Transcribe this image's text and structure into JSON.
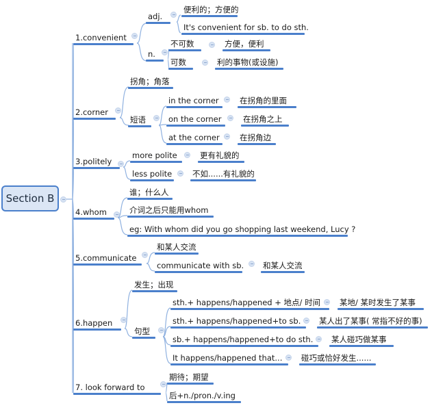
{
  "root": "Section B",
  "branches": [
    {
      "label": "1.convenient",
      "children": [
        {
          "label": "adj.",
          "children": [
            {
              "label": "便利的；方便的"
            },
            {
              "label": "It's convenient for sb. to do sth."
            }
          ]
        },
        {
          "label": "n.",
          "children": [
            {
              "label": "不可数",
              "note": "方便，便利"
            },
            {
              "label": "可数",
              "note": "利的事物(或设施)"
            }
          ]
        }
      ]
    },
    {
      "label": "2.corner",
      "children": [
        {
          "label": "拐角；角落"
        },
        {
          "label": "短语",
          "children": [
            {
              "label": "in the corner",
              "note": "在拐角的里面"
            },
            {
              "label": "on the corner",
              "note": "在拐角之上"
            },
            {
              "label": "at the corner",
              "note": "在拐角边"
            }
          ]
        }
      ]
    },
    {
      "label": "3.politely",
      "children": [
        {
          "label": "more polite",
          "note": "更有礼貌的"
        },
        {
          "label": "less polite",
          "note": "不如......有礼貌的"
        }
      ]
    },
    {
      "label": "4.whom",
      "children": [
        {
          "label": "谁；什么人"
        },
        {
          "label": "介词之后只能用whom"
        },
        {
          "label": "eg: With whom did you go shopping last weekend, Lucy ?"
        }
      ]
    },
    {
      "label": "5.communicate",
      "children": [
        {
          "label": "和某人交流"
        },
        {
          "label": "communicate with sb.",
          "note": "和某人交流"
        }
      ]
    },
    {
      "label": "6.happen",
      "children": [
        {
          "label": "发生；出现"
        },
        {
          "label": "句型",
          "children": [
            {
              "label": "sth.+ happens/happened + 地点/ 时间",
              "note": "某地/ 某时发生了某事"
            },
            {
              "label": "sth.+ happens/happened+to sb.",
              "note": "某人出了某事( 常指不好的事)"
            },
            {
              "label": "sb.+ happens/happened+to do sth.",
              "note": "某人碰巧做某事"
            },
            {
              "label": "It happens/happened that...",
              "note": "碰巧或恰好发生......"
            }
          ]
        }
      ]
    },
    {
      "label": "7. look forward to",
      "children": [
        {
          "label": "期待；期望"
        },
        {
          "label": "后+n./pron./v.ing"
        }
      ]
    }
  ],
  "colors": {
    "line": "#4a7fcb",
    "curve": "#8fb1e0",
    "root_fill": "#dbe6f5"
  }
}
